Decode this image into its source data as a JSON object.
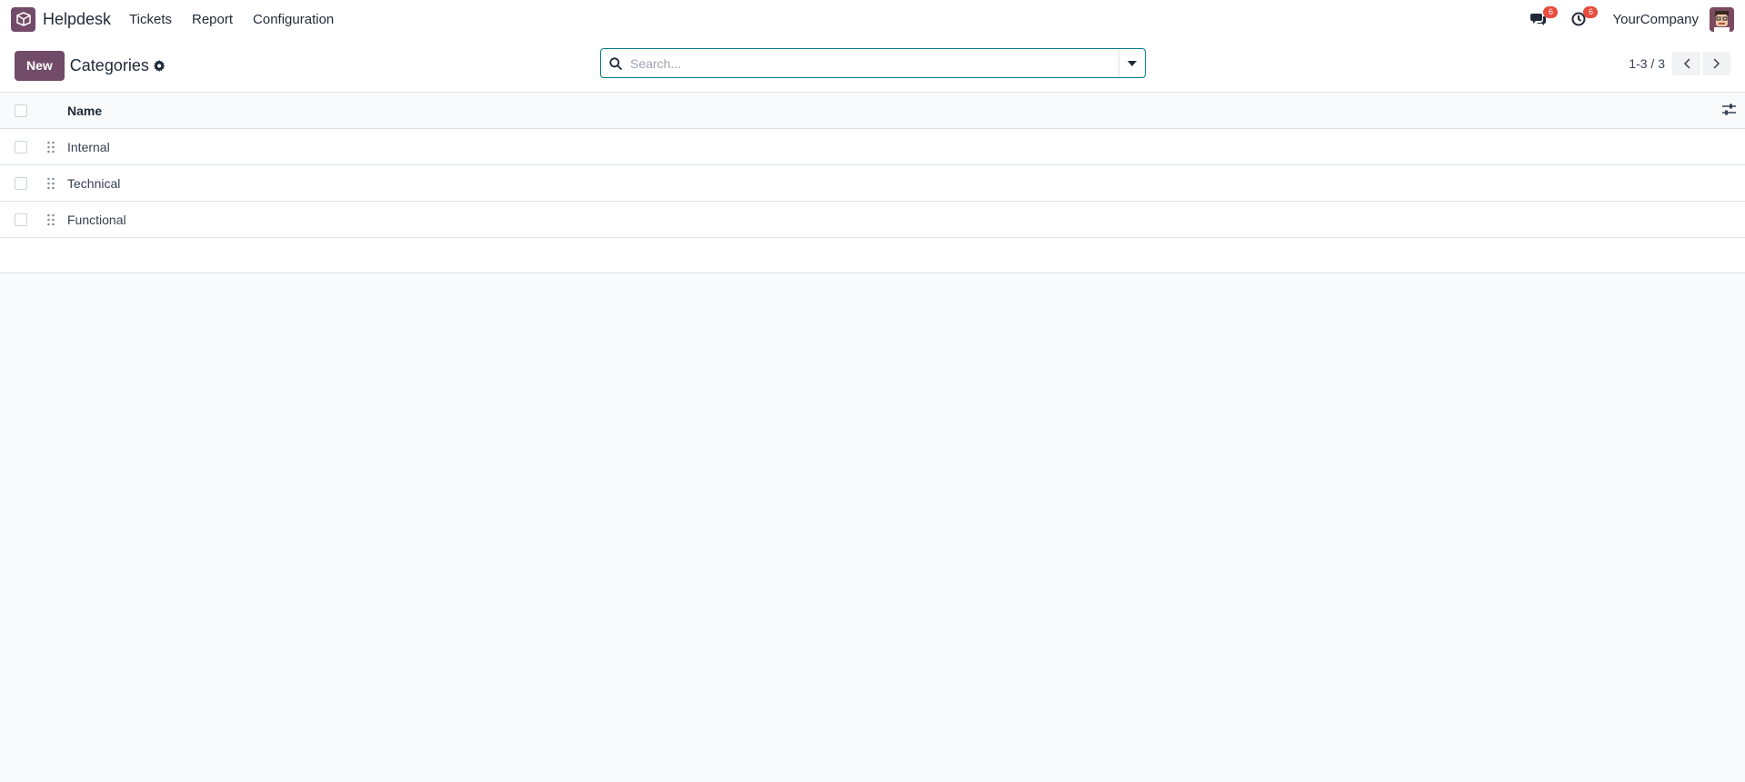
{
  "navbar": {
    "app_name": "Helpdesk",
    "menu": [
      "Tickets",
      "Report",
      "Configuration"
    ],
    "messages_count": "6",
    "activities_count": "6",
    "company": "YourCompany"
  },
  "control_panel": {
    "new_label": "New",
    "title": "Categories",
    "search_placeholder": "Search...",
    "pager": "1-3 / 3"
  },
  "list": {
    "header": "Name",
    "rows": [
      "Internal",
      "Technical",
      "Functional"
    ]
  },
  "colors": {
    "brand": "#714b67",
    "search_border": "#017e84",
    "badge": "#e74c3c"
  }
}
